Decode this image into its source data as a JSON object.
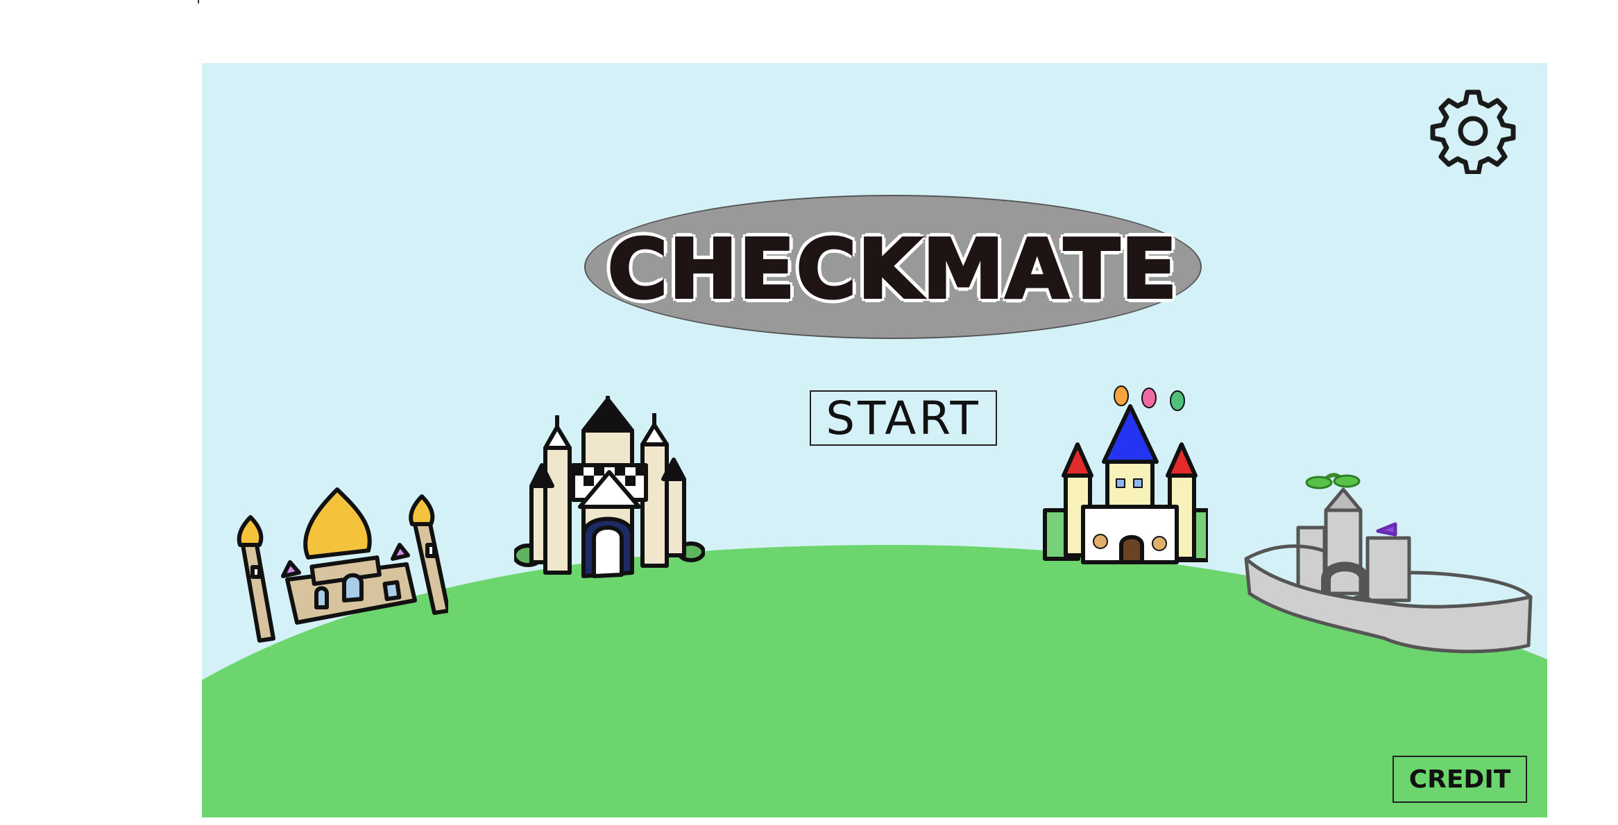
{
  "game": {
    "title": "CHECKMATE",
    "start_label": "START",
    "credit_label": "CREDIT"
  },
  "icons": {
    "settings": "gear-icon"
  },
  "colors": {
    "sky": "#d3f1f6",
    "hill": "#6dd56d",
    "title_plate": "#999999",
    "title_text": "#1e1414",
    "gear": "#1a1a1a"
  },
  "scene": {
    "castles": [
      {
        "name": "onion-dome-palace"
      },
      {
        "name": "checkered-castle"
      },
      {
        "name": "candy-castle"
      },
      {
        "name": "stone-fortress"
      }
    ]
  }
}
